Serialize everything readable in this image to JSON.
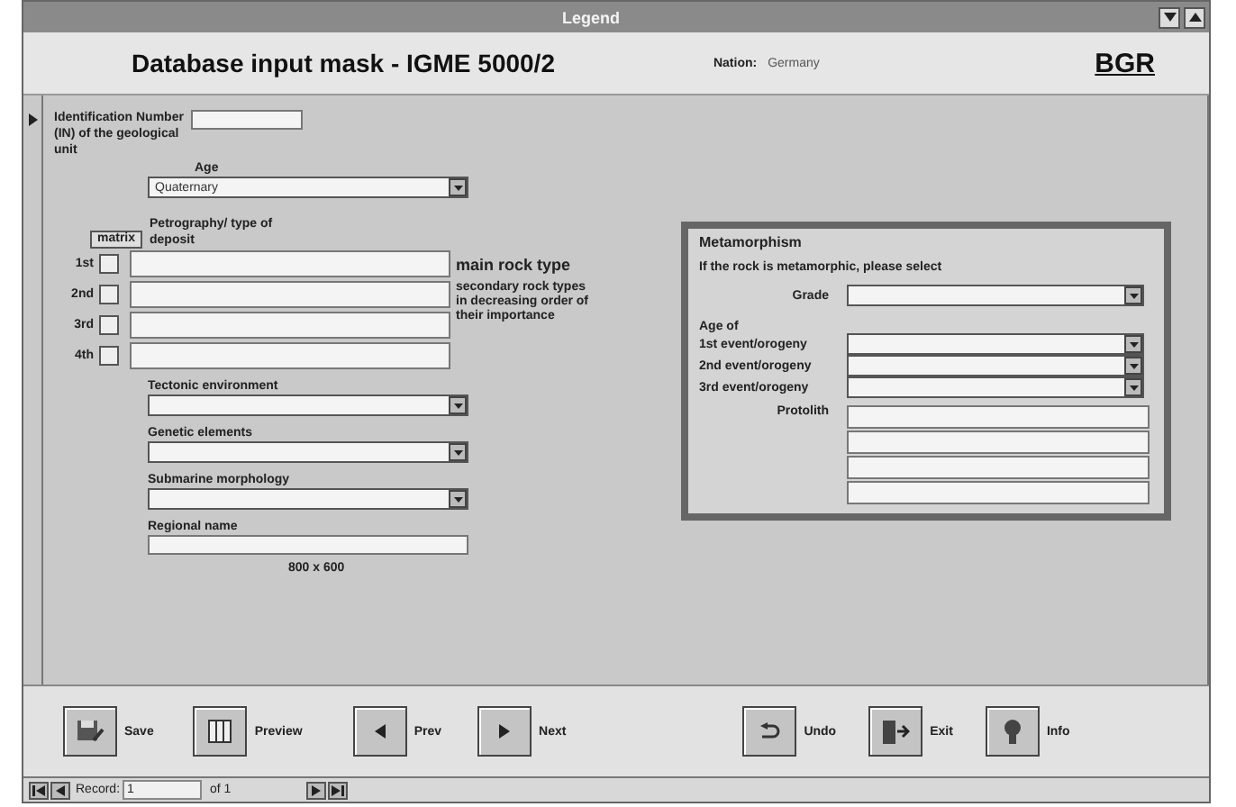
{
  "window": {
    "title": "Legend"
  },
  "header": {
    "title": "Database input mask - IGME 5000/2",
    "nation_label": "Nation:",
    "nation": "Germany",
    "logo": "BGR"
  },
  "id_field": {
    "label": "Identification Number (IN) of the geological unit"
  },
  "age": {
    "label": "Age",
    "value": "Quaternary"
  },
  "petrography": {
    "label": "Petrography/ type of deposit",
    "matrix_label": "matrix",
    "main_note": "main rock type",
    "secondary_note": "secondary rock types in decreasing order of their importance",
    "rows": [
      {
        "label": "1st",
        "checked": false
      },
      {
        "label": "2nd",
        "checked": false
      },
      {
        "label": "3rd",
        "checked": false
      },
      {
        "label": "4th",
        "checked": false
      }
    ]
  },
  "dropdowns": [
    {
      "label": "Tectonic environment"
    },
    {
      "label": "Genetic elements"
    },
    {
      "label": "Submarine morphology"
    }
  ],
  "regional_name": {
    "label": "Regional name"
  },
  "resolution_note": "800 x 600",
  "metamorphism": {
    "title": "Metamorphism",
    "hint": "If the rock is metamorphic, please select",
    "grade_label": "Grade",
    "age_label": "Age of",
    "events": [
      {
        "label": "1st event/orogeny"
      },
      {
        "label": "2nd event/orogeny"
      },
      {
        "label": "3rd event/orogeny"
      }
    ],
    "protolith_label": "Protolith"
  },
  "toolbar": [
    {
      "label": "Save",
      "kind": "save"
    },
    {
      "label": "Preview",
      "kind": "preview"
    },
    {
      "label": "Prev",
      "kind": "prev"
    },
    {
      "label": "Next",
      "kind": "next"
    },
    {
      "label": "Undo",
      "kind": "undo"
    },
    {
      "label": "Exit",
      "kind": "exit"
    },
    {
      "label": "Info",
      "kind": "info"
    }
  ],
  "navigation": {
    "label": "Record:",
    "current": "1",
    "total": "of 1"
  }
}
